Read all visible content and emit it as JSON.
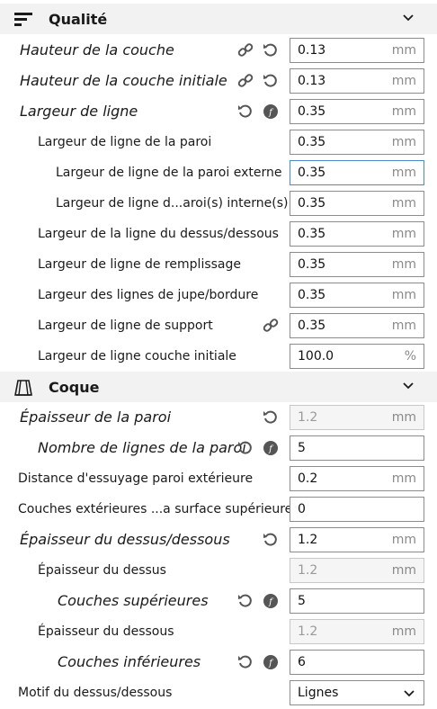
{
  "sections": {
    "qualite": {
      "title": "Qualité"
    },
    "coque": {
      "title": "Coque"
    }
  },
  "rows": {
    "r1": {
      "label": "Hauteur de la couche",
      "value": "0.13",
      "unit": "mm"
    },
    "r2": {
      "label": "Hauteur de la couche initiale",
      "value": "0.13",
      "unit": "mm"
    },
    "r3": {
      "label": "Largeur de ligne",
      "value": "0.35",
      "unit": "mm"
    },
    "r4": {
      "label": "Largeur de ligne de la paroi",
      "value": "0.35",
      "unit": "mm"
    },
    "r5": {
      "label": "Largeur de ligne de la paroi externe",
      "value": "0.35",
      "unit": "mm"
    },
    "r6": {
      "label": "Largeur de ligne d...aroi(s) interne(s)",
      "value": "0.35",
      "unit": "mm"
    },
    "r7": {
      "label": "Largeur de la ligne du dessus/dessous",
      "value": "0.35",
      "unit": "mm"
    },
    "r8": {
      "label": "Largeur de ligne de remplissage",
      "value": "0.35",
      "unit": "mm"
    },
    "r9": {
      "label": "Largeur des lignes de jupe/bordure",
      "value": "0.35",
      "unit": "mm"
    },
    "r10": {
      "label": "Largeur de ligne de support",
      "value": "0.35",
      "unit": "mm"
    },
    "r11": {
      "label": "Largeur de ligne couche initiale",
      "value": "100.0",
      "unit": "%"
    },
    "c1": {
      "label": "Épaisseur de la paroi",
      "value": "1.2",
      "unit": "mm"
    },
    "c2": {
      "label": "Nombre de lignes de la paroi",
      "value": "5",
      "unit": ""
    },
    "c3": {
      "label": "Distance d'essuyage paroi extérieure",
      "value": "0.2",
      "unit": "mm"
    },
    "c4": {
      "label": "Couches extérieures ...a surface supérieure",
      "value": "0",
      "unit": ""
    },
    "c5": {
      "label": "Épaisseur du dessus/dessous",
      "value": "1.2",
      "unit": "mm"
    },
    "c6": {
      "label": "Épaisseur du dessus",
      "value": "1.2",
      "unit": "mm"
    },
    "c7": {
      "label": "Couches supérieures",
      "value": "5",
      "unit": ""
    },
    "c8": {
      "label": "Épaisseur du dessous",
      "value": "1.2",
      "unit": "mm"
    },
    "c9": {
      "label": "Couches inférieures",
      "value": "6",
      "unit": ""
    },
    "c10": {
      "label": "Motif du dessus/dessous",
      "value": "Lignes",
      "unit": ""
    }
  },
  "icons": {
    "link": "link-icon",
    "reset": "reset-icon",
    "function": "function-icon",
    "chevron": "chevron-down-icon",
    "quality": "quality-section-icon",
    "shell": "shell-section-icon"
  },
  "colors": {
    "header_bg": "#f2f2f2",
    "field_border": "#8c8c8c",
    "focused_border": "#4a8ac9",
    "disabled_bg": "#f5f5f5"
  }
}
